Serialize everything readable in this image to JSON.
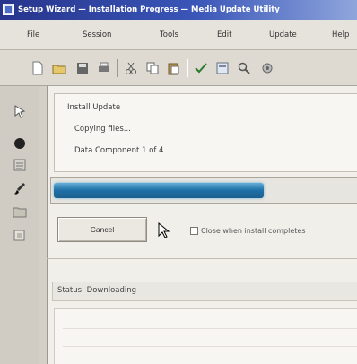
{
  "window": {
    "title": "Setup Wizard — Installation Progress — Media Update Utility"
  },
  "menu": {
    "items": [
      "File",
      "Session",
      "Tools",
      "Edit",
      "Update",
      "Help"
    ]
  },
  "toolbar": {
    "icons": [
      "new-icon",
      "open-icon",
      "save-icon",
      "print-icon",
      "cut-icon",
      "copy-icon",
      "paste-icon",
      "check-icon",
      "preview-icon",
      "zoom-icon",
      "settings-icon"
    ]
  },
  "sidebar": {
    "icons": [
      "select-icon",
      "record-icon",
      "list-icon",
      "brush-icon",
      "folder-icon",
      "layers-icon"
    ]
  },
  "info": {
    "line1": "Install Update",
    "line2": "Copying files...",
    "line3": "Data Component 1 of 4"
  },
  "progress": {
    "value": 0.7
  },
  "actions": {
    "button_label": "Cancel",
    "checkbox_label": "Close when install completes"
  },
  "status": {
    "text": "Status: Downloading"
  },
  "colors": {
    "titlebar": "#26348c",
    "progress": "#1e6fa6"
  }
}
